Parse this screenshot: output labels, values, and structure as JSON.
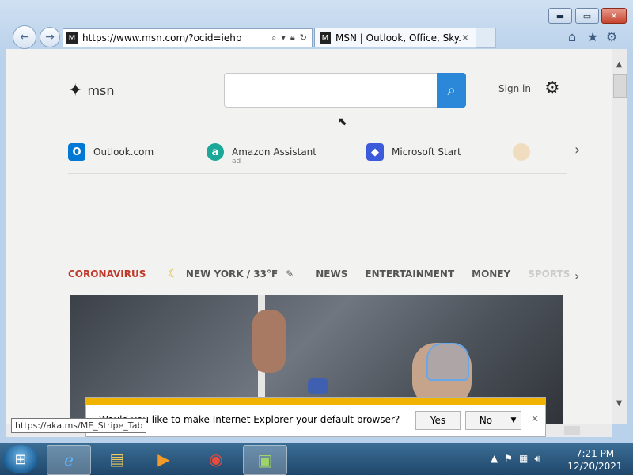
{
  "browser": {
    "window_controls": {
      "minimize": "▬",
      "maximize": "▭",
      "close": "✕"
    },
    "back_icon": "←",
    "forward_icon": "→",
    "address_url": "https://www.msn.com/?ocid=iehp",
    "tab_title": "MSN | Outlook, Office, Sky...",
    "tab_close": "✕",
    "toolbar_icons": {
      "home": "⌂",
      "favorites": "★",
      "tools": "⚙"
    }
  },
  "page": {
    "logo_text": "msn",
    "sign_in": "Sign in",
    "quick_links": [
      {
        "label": "Outlook.com",
        "sub": "",
        "icon": "O",
        "color": "#0078d4"
      },
      {
        "label": "Amazon Assistant",
        "sub": "ad",
        "icon": "a",
        "color": "#1ba898"
      },
      {
        "label": "Microsoft Start",
        "sub": "",
        "icon": "◆",
        "color": "#3b5bdb"
      }
    ],
    "nav": {
      "coronavirus": "CORONAVIRUS",
      "weather": "NEW YORK / 33°F",
      "items": [
        "NEWS",
        "ENTERTAINMENT",
        "MONEY"
      ],
      "faded": "SPORTS"
    }
  },
  "dialog": {
    "question": "Would you like to make Internet Explorer your default browser?",
    "yes": "Yes",
    "no": "No"
  },
  "status_tooltip": "https://aka.ms/ME_Stripe_Tab",
  "taskbar": {
    "time": "7:21 PM",
    "date": "12/20/2021"
  }
}
